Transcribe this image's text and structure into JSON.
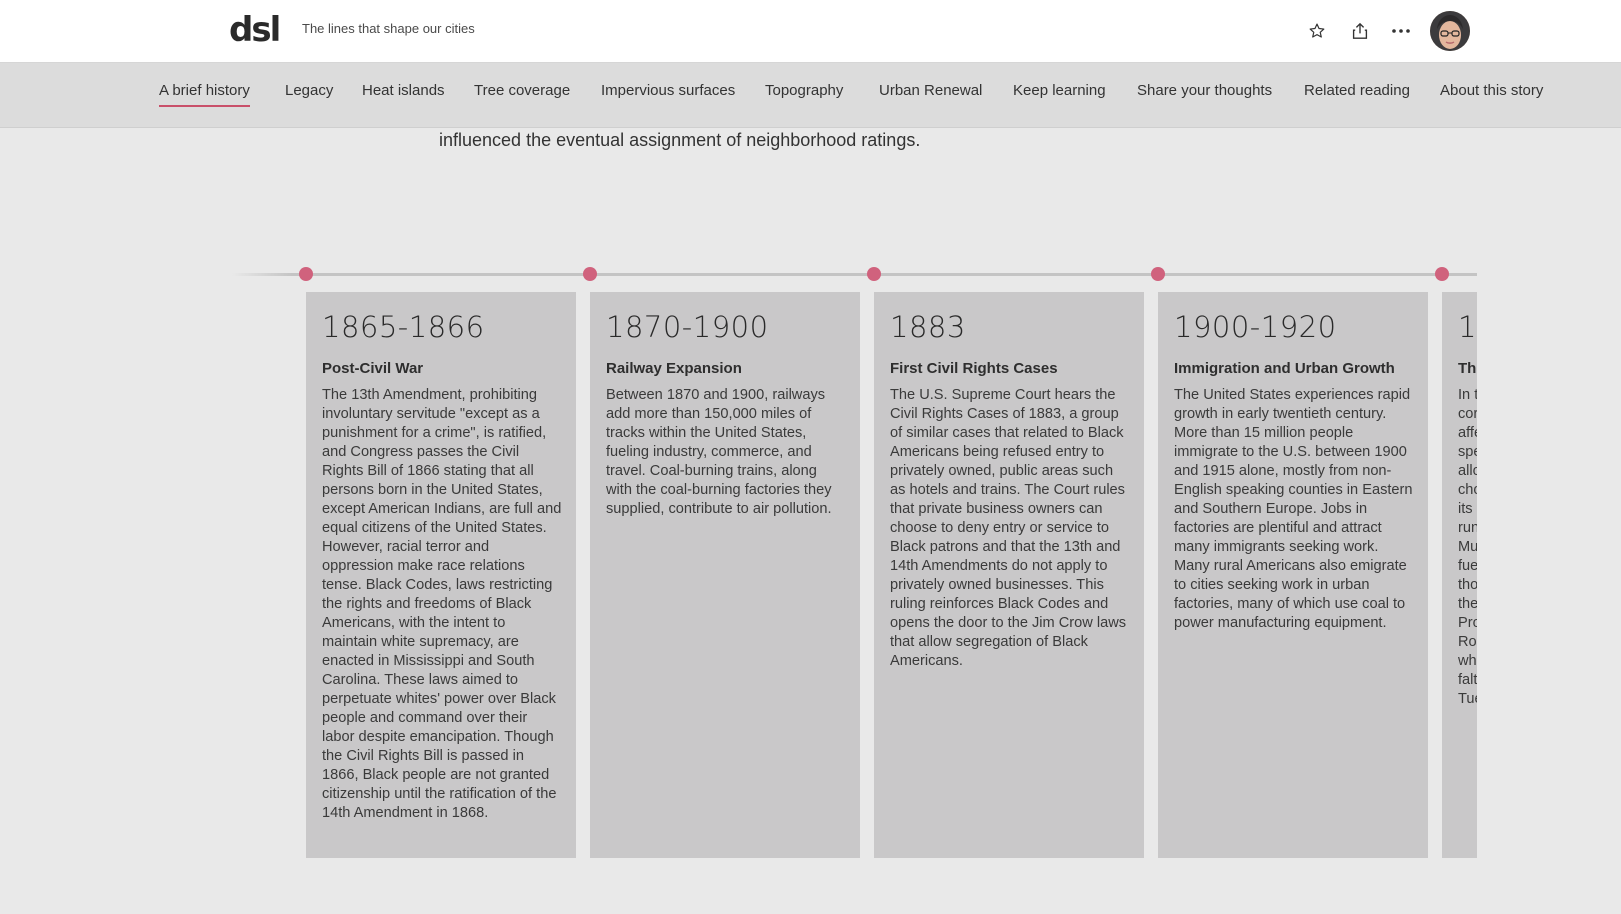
{
  "header": {
    "logo": "dsl",
    "tagline": "The lines that shape our cities",
    "icons": [
      "star-icon",
      "share-icon",
      "more-icon"
    ]
  },
  "nav": {
    "items": [
      {
        "label": "A brief history",
        "active": true
      },
      {
        "label": "Legacy"
      },
      {
        "label": "Heat islands"
      },
      {
        "label": "Tree coverage"
      },
      {
        "label": "Impervious surfaces"
      },
      {
        "label": "Topography"
      },
      {
        "label": "Urban Renewal"
      },
      {
        "label": "Keep learning"
      },
      {
        "label": "Share your thoughts"
      },
      {
        "label": "Related reading"
      },
      {
        "label": "About this story"
      }
    ]
  },
  "intro_text": "influenced the eventual assignment of neighborhood ratings.",
  "timeline": {
    "accent_color": "#d0627d",
    "cards": [
      {
        "year": "1865-1866",
        "title": "Post-Civil War",
        "body": "The 13th Amendment, prohibiting involuntary servitude \"except as a punishment for a crime\", is ratified, and Congress passes the Civil Rights Bill of 1866 stating that all persons born in the United States, except American Indians, are full and equal citizens of the United States. However, racial terror and oppression make race relations tense. Black Codes, laws restricting the rights and freedoms of Black Americans, with the intent to maintain white supremacy, are enacted in Mississippi and South Carolina. These laws aimed to perpetuate whites' power over Black people and command over their labor despite emancipation. Though the Civil Rights Bill is passed in 1866, Black people are not granted citizenship until the ratification of the 14th Amendment in 1868."
      },
      {
        "year": "1870-1900",
        "title": "Railway Expansion",
        "body": "Between 1870 and 1900, railways add more than 150,000 miles of tracks within the United States, fueling industry, commerce, and travel. Coal-burning trains, along with the coal-burning factories they supplied, contribute to air pollution."
      },
      {
        "year": "1883",
        "title": "First Civil Rights Cases",
        "body": "The U.S. Supreme Court hears the Civil Rights Cases of 1883, a group of similar cases that related to Black Americans being refused entry to privately owned, public areas such as hotels and trains. The Court rules that private business owners can choose to deny entry or service to Black patrons and that the 13th and 14th Amendments do not apply to privately owned businesses. This ruling reinforces Black Codes and opens the door to the Jim Crow laws that allow segregation of Black Americans."
      },
      {
        "year": "1900-1920",
        "title": "Immigration and Urban Growth",
        "body": "The United States experiences rapid growth in early twentieth century. More than 15 million people immigrate to the U.S. between 1900 and 1915 alone, mostly from non-English speaking counties in Eastern and Southern Europe. Jobs in factories are plentiful and attract many immigrants seeking work. Many rural Americans also emigrate to cities seeking work in urban factories, many of which use coal to power manufacturing equipment."
      },
      {
        "year": "1",
        "title": "The",
        "body_lines": [
          "In t",
          "cor",
          "affe",
          "spe",
          "allo",
          "cho",
          "its",
          "run",
          "Mu",
          "fue",
          "tho",
          "the",
          "Pro",
          "Roo",
          "whi",
          "falt",
          "Tue"
        ]
      }
    ]
  }
}
